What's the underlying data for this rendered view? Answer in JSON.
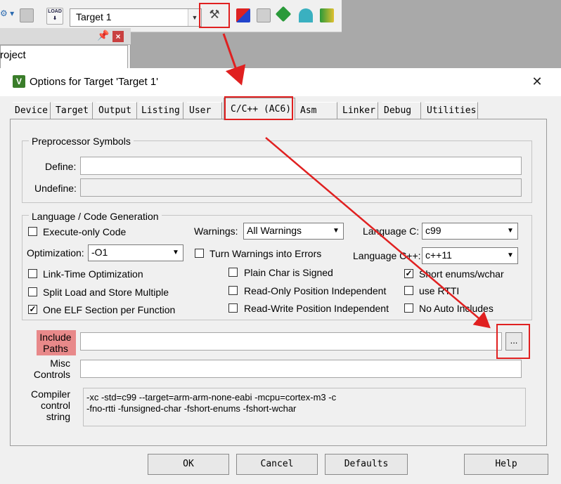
{
  "ide": {
    "target_name": "Target 1",
    "panel_title_fragment": "roject",
    "load_icon_text": "LOAD"
  },
  "dialog": {
    "title": "Options for Target 'Target 1'",
    "close": "✕",
    "tabs": [
      "Device",
      "Target",
      "Output",
      "Listing",
      "User",
      "C/C++ (AC6)",
      "Asm",
      "Linker",
      "Debug",
      "Utilities"
    ],
    "active_tab": "C/C++ (AC6)"
  },
  "preprocessor": {
    "title": "Preprocessor Symbols",
    "define_label": "Define:",
    "define_value": "",
    "undefine_label": "Undefine:",
    "undefine_value": ""
  },
  "language": {
    "title": "Language / Code Generation",
    "execute_only": {
      "label": "Execute-only Code",
      "checked": false
    },
    "optimization_label": "Optimization:",
    "optimization_value": "-O1",
    "lto": {
      "label": "Link-Time Optimization",
      "checked": false
    },
    "split_ls": {
      "label": "Split Load and Store Multiple",
      "checked": false
    },
    "one_elf": {
      "label": "One ELF Section per Function",
      "checked": true
    },
    "warnings_label": "Warnings:",
    "warnings_value": "All Warnings",
    "warnings_errors": {
      "label": "Turn Warnings into Errors",
      "checked": false
    },
    "plain_char": {
      "label": "Plain Char is Signed",
      "checked": false
    },
    "ropi": {
      "label": "Read-Only Position Independent",
      "checked": false
    },
    "rwpi": {
      "label": "Read-Write Position Independent",
      "checked": false
    },
    "lang_c_label": "Language C:",
    "lang_c_value": "c99",
    "lang_cpp_label": "Language C++:",
    "lang_cpp_value": "c++11",
    "short_enums": {
      "label": "Short enums/wchar",
      "checked": true
    },
    "use_rtti": {
      "label": "use RTTI",
      "checked": false
    },
    "no_auto_includes": {
      "label": "No Auto Includes",
      "checked": false
    }
  },
  "paths": {
    "include_label_1": "Include",
    "include_label_2": "Paths",
    "include_value": "",
    "browse_label": "...",
    "misc_label_1": "Misc",
    "misc_label_2": "Controls",
    "misc_value": "",
    "compiler_label_1": "Compiler",
    "compiler_label_2": "control",
    "compiler_label_3": "string",
    "compiler_line_1": "-xc -std=c99 --target=arm-arm-none-eabi -mcpu=cortex-m3 -c",
    "compiler_line_2": "-fno-rtti -funsigned-char -fshort-enums -fshort-wchar"
  },
  "buttons": {
    "ok": "OK",
    "cancel": "Cancel",
    "defaults": "Defaults",
    "help": "Help"
  },
  "colors": {
    "annotation_red": "#e02020",
    "include_highlight": "#e8898a"
  }
}
